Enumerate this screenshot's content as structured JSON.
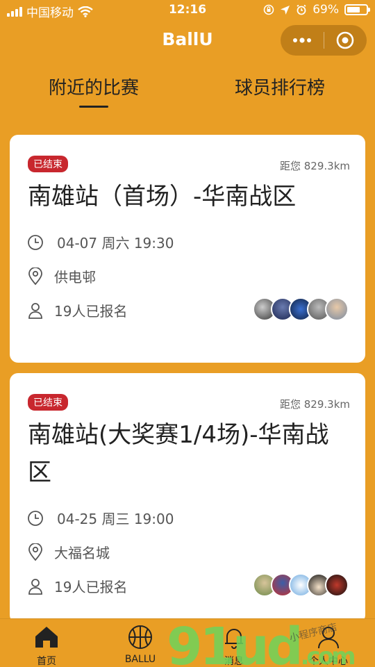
{
  "status_bar": {
    "carrier": "中国移动",
    "time": "12:16",
    "battery_percent": "69%",
    "battery_level": 0.69
  },
  "nav": {
    "title": "BallU",
    "menu_icon": "more-dots-icon",
    "close_icon": "target-circle-icon"
  },
  "tabs": [
    {
      "label": "附近的比赛",
      "active": true
    },
    {
      "label": "球员排行榜",
      "active": false
    }
  ],
  "matches": [
    {
      "status": "已结束",
      "distance": "距您 829.3km",
      "title": "南雄站（首场）-华南战区",
      "datetime": "04-07 周六 19:30",
      "venue": "供电邨",
      "signups": "19人已报名"
    },
    {
      "status": "已结束",
      "distance": "距您 829.3km",
      "title": "南雄站(大奖赛1/4场)-华南战区",
      "datetime": "04-25 周三 19:00",
      "venue": "大福名城",
      "signups": "19人已报名"
    }
  ],
  "tabbar": [
    {
      "label": "首页",
      "icon": "home-icon",
      "active": true
    },
    {
      "label": "BALLU",
      "icon": "basketball-icon",
      "active": false
    },
    {
      "label": "消息",
      "icon": "bell-icon",
      "active": false
    },
    {
      "label": "个人中心",
      "icon": "user-icon",
      "active": false
    }
  ],
  "watermark": {
    "logo_text": "91ud",
    "suffix": ".com",
    "tag": "小程序商店"
  },
  "colors": {
    "brand": "#E99E25",
    "badge": "#C8272E",
    "card": "#FFFFFF"
  }
}
